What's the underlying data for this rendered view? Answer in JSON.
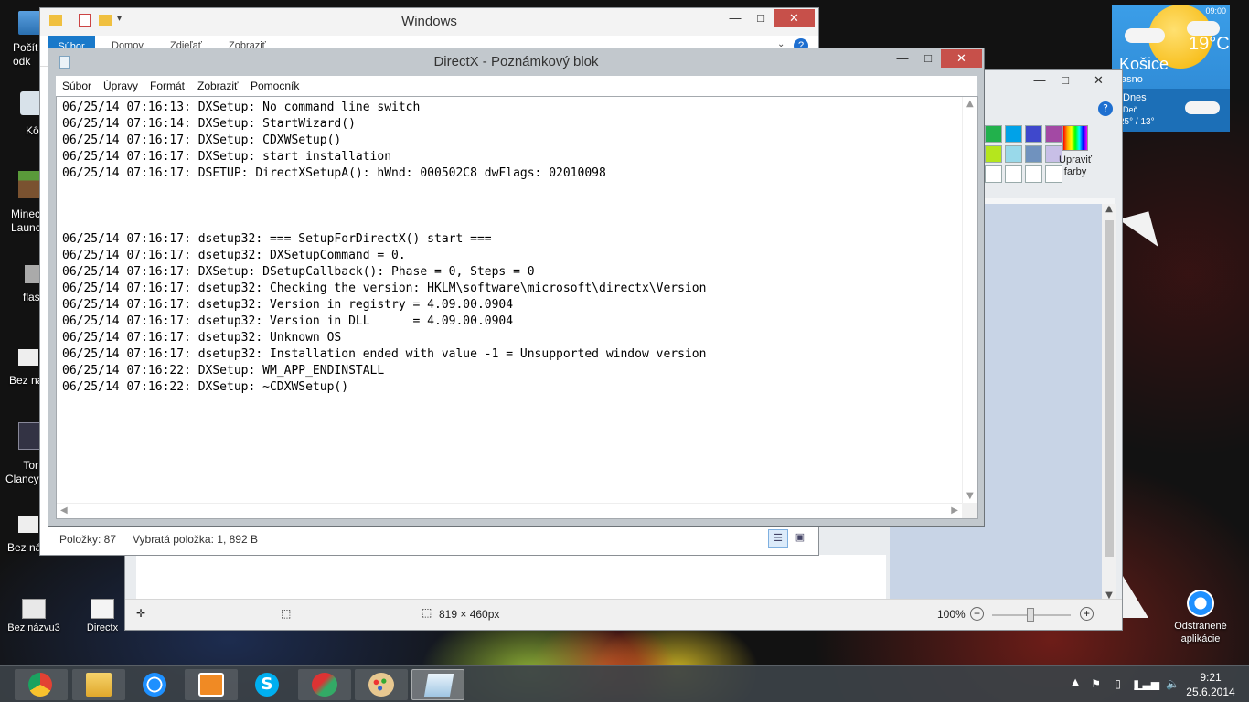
{
  "desktop": {
    "left_icons": [
      {
        "label": "Počít\nodk"
      },
      {
        "label": "Kô"
      },
      {
        "label": "Minec\nLaunc"
      },
      {
        "label": "flas"
      },
      {
        "label": "Bez ná"
      },
      {
        "label": "Tor\nClancy"
      },
      {
        "label": "Bez ná"
      }
    ],
    "bottom_icons": [
      {
        "label": "Bez názvu3"
      },
      {
        "label": "Directx"
      }
    ],
    "right_icon": {
      "label": "Odstránené\naplikácie"
    }
  },
  "weather": {
    "time": "09:00",
    "temp": "19°C",
    "city": "Košice",
    "cond": "asno",
    "day": "Dnes",
    "day_sub": "Deň",
    "range": "25° / 13°"
  },
  "explorer": {
    "title": "Windows",
    "tabs": [
      "Súbor",
      "Domov",
      "Zdieľať",
      "Zobraziť"
    ],
    "status": {
      "items": "Položky: 87",
      "selected": "Vybratá položka: 1, 892 B"
    }
  },
  "paint": {
    "edit_colors_label": "Upraviť\nfarby",
    "status": {
      "size": "819 × 460px",
      "zoom": "100%"
    },
    "palette": [
      "#22b14c",
      "#00a2e8",
      "#3f48cc",
      "#a349a4",
      "#b5e61d",
      "#99d9ea",
      "#7092be",
      "#c8bfe7",
      "#ffffff",
      "#ffffff",
      "#ffffff",
      "#ffffff"
    ]
  },
  "notepad": {
    "title": "DirectX - Poznámkový blok",
    "menu": [
      "Súbor",
      "Úpravy",
      "Formát",
      "Zobraziť",
      "Pomocník"
    ],
    "lines": [
      "06/25/14 07:16:13: DXSetup: No command line switch",
      "06/25/14 07:16:14: DXSetup: StartWizard()",
      "06/25/14 07:16:17: DXSetup: CDXWSetup()",
      "06/25/14 07:16:17: DXSetup: start installation",
      "06/25/14 07:16:17: DSETUP: DirectXSetupA(): hWnd: 000502C8 dwFlags: 02010098",
      "",
      "",
      "",
      "06/25/14 07:16:17: dsetup32: === SetupForDirectX() start ===",
      "06/25/14 07:16:17: dsetup32: DXSetupCommand = 0.",
      "06/25/14 07:16:17: DXSetup: DSetupCallback(): Phase = 0, Steps = 0",
      "06/25/14 07:16:17: dsetup32: Checking the version: HKLM\\software\\microsoft\\directx\\Version",
      "06/25/14 07:16:17: dsetup32: Version in registry = 4.09.00.0904",
      "06/25/14 07:16:17: dsetup32: Version in DLL      = 4.09.00.0904",
      "06/25/14 07:16:17: dsetup32: Unknown OS",
      "06/25/14 07:16:17: dsetup32: Installation ended with value -1 = Unsupported window version",
      "06/25/14 07:16:22: DXSetup: WM_APP_ENDINSTALL",
      "06/25/14 07:16:22: DXSetup: ~CDXWSetup()"
    ]
  },
  "taskbar": {
    "items": [
      {
        "icon": "chrome-icon",
        "color": "#e34133"
      },
      {
        "icon": "file-explorer-icon",
        "color": "#f2c94c"
      },
      {
        "icon": "internet-explorer-icon",
        "color": "#1e90ff"
      },
      {
        "icon": "media-player-icon",
        "color": "#f08a24"
      },
      {
        "icon": "skype-icon",
        "color": "#00aff0"
      },
      {
        "icon": "ccleaner-icon",
        "color": "#d33"
      },
      {
        "icon": "paint-icon",
        "color": "#e0b060"
      },
      {
        "icon": "notepad-icon",
        "color": "#7fb3d5"
      }
    ],
    "clock_time": "9:21",
    "clock_date": "25.6.2014"
  }
}
